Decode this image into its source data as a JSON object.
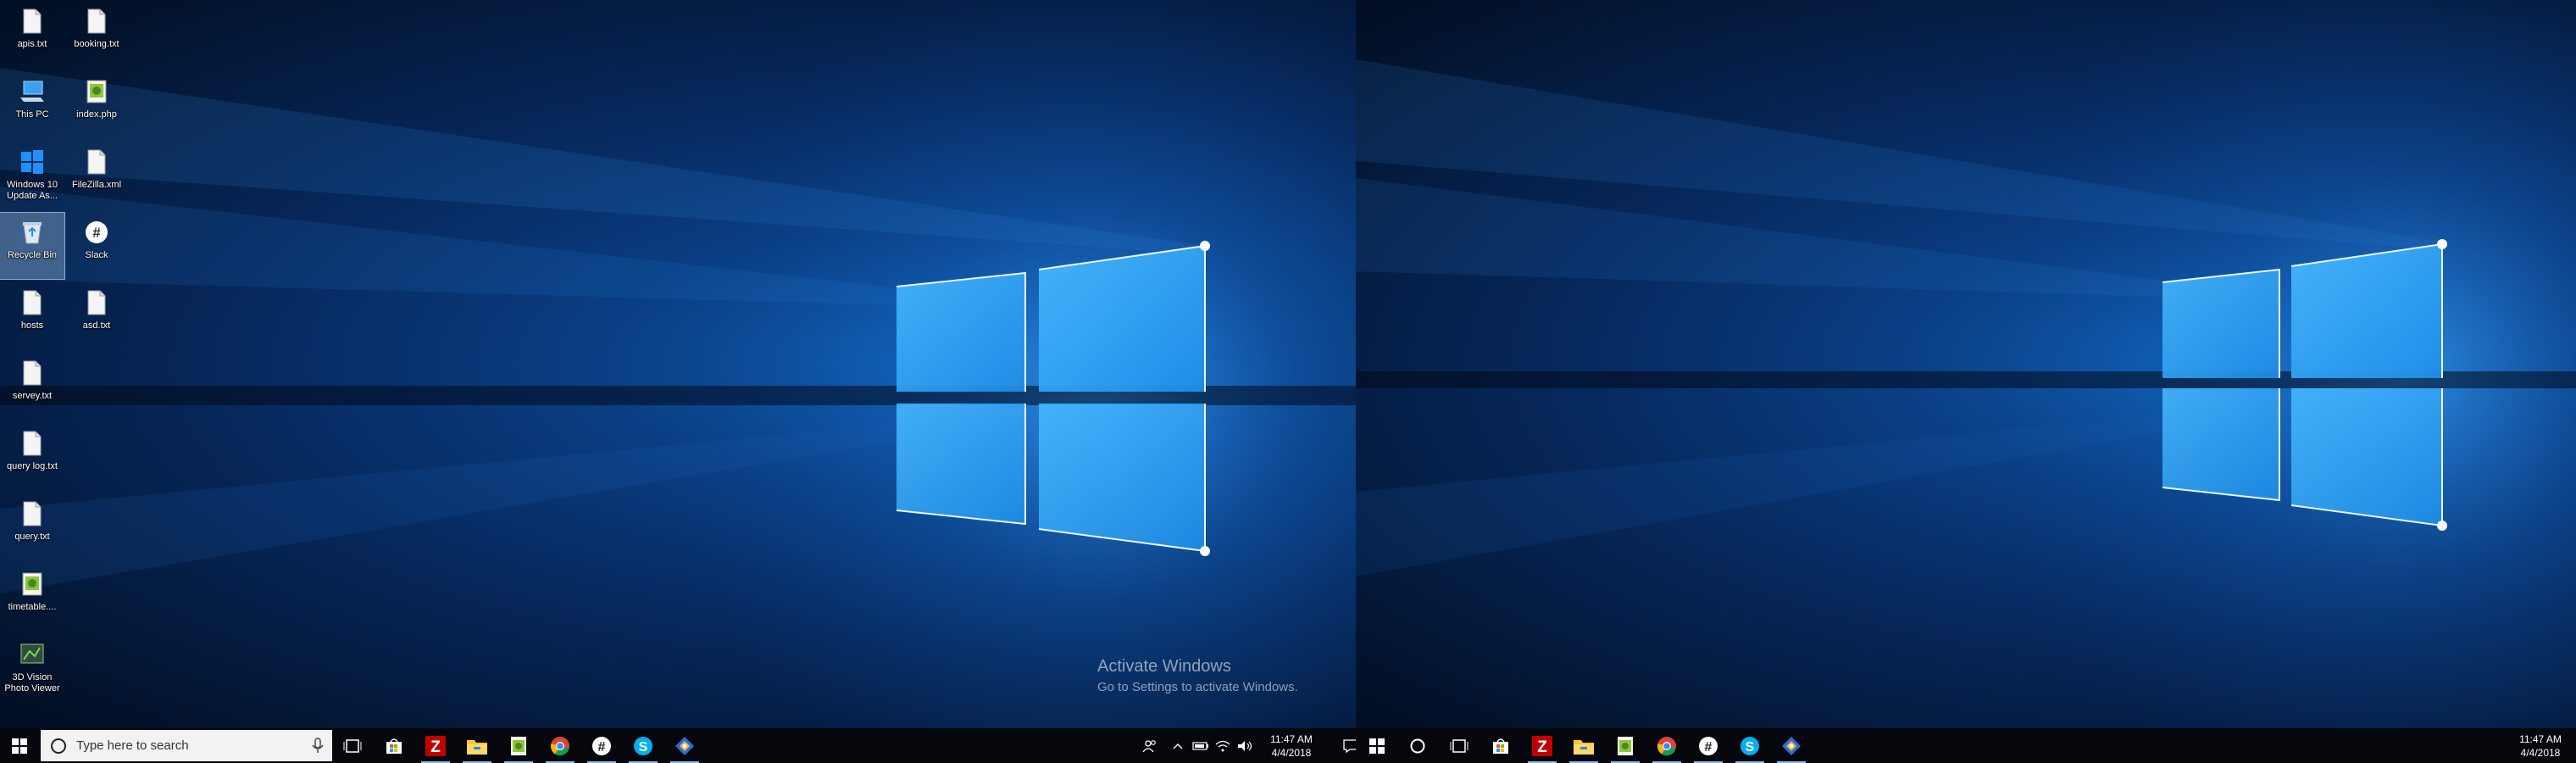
{
  "left_monitor": {
    "desktop_icons": [
      {
        "label": "apis.txt",
        "icon": "text-file-icon"
      },
      {
        "label": "booking.txt",
        "icon": "text-file-icon"
      },
      {
        "label": "This PC",
        "icon": "this-pc-icon"
      },
      {
        "label": "index.php",
        "icon": "notepad-plus-icon"
      },
      {
        "label": "Windows 10 Update As...",
        "icon": "windows-update-assistant-icon"
      },
      {
        "label": "FileZilla.xml",
        "icon": "text-file-icon"
      },
      {
        "label": "Recycle Bin",
        "icon": "recycle-bin-icon",
        "selected": true
      },
      {
        "label": "Slack",
        "icon": "slack-icon"
      },
      {
        "label": "hosts",
        "icon": "text-file-icon"
      },
      {
        "label": "asd.txt",
        "icon": "text-file-icon"
      },
      {
        "label": "servey.txt",
        "icon": "text-file-icon"
      },
      {
        "label": "query log.txt",
        "icon": "text-file-icon"
      },
      {
        "label": "query.txt",
        "icon": "text-file-icon"
      },
      {
        "label": "timetable....",
        "icon": "notepad-plus-icon"
      },
      {
        "label": "3D Vision Photo Viewer",
        "icon": "3d-vision-icon"
      }
    ],
    "watermark": {
      "title": "Activate Windows",
      "subtitle": "Go to Settings to activate Windows."
    },
    "taskbar": {
      "search_placeholder": "Type here to search",
      "apps": [
        {
          "name": "task-view-icon"
        },
        {
          "name": "store-icon"
        },
        {
          "name": "filezilla-icon",
          "running": true
        },
        {
          "name": "file-explorer-icon",
          "running": true
        },
        {
          "name": "notepad-plus-icon",
          "running": true
        },
        {
          "name": "chrome-icon",
          "running": true
        },
        {
          "name": "slack-icon",
          "running": true
        },
        {
          "name": "skype-icon",
          "running": true
        },
        {
          "name": "sourcetree-icon",
          "running": true
        }
      ],
      "time": "11:47 AM",
      "date": "4/4/2018"
    }
  },
  "right_monitor": {
    "taskbar": {
      "apps": [
        {
          "name": "cortana-circle-icon"
        },
        {
          "name": "task-view-icon"
        },
        {
          "name": "store-icon"
        },
        {
          "name": "filezilla-icon",
          "running": true
        },
        {
          "name": "file-explorer-icon",
          "running": true
        },
        {
          "name": "notepad-plus-icon",
          "running": true
        },
        {
          "name": "chrome-icon",
          "running": true
        },
        {
          "name": "slack-icon",
          "running": true
        },
        {
          "name": "skype-icon",
          "running": true
        },
        {
          "name": "sourcetree-icon",
          "running": true
        }
      ],
      "time": "11:47 AM",
      "date": "4/4/2018"
    }
  },
  "colors": {
    "wallpaper_blue": "#0a3f85",
    "taskbar": "#05070d",
    "running_indicator": "#8ab8e8"
  }
}
